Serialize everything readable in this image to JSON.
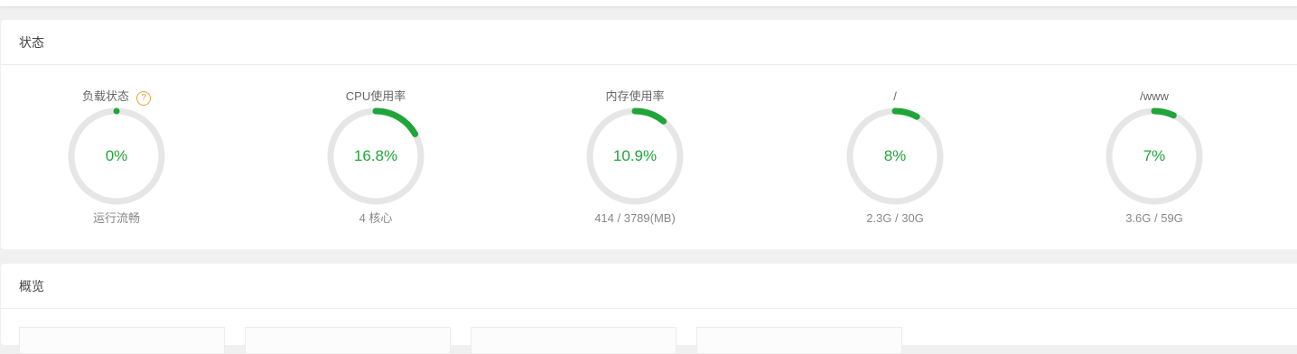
{
  "status_panel": {
    "title": "状态",
    "gauges": [
      {
        "key": "load",
        "label": "负载状态",
        "has_help": true,
        "help_glyph": "?",
        "value_text": "0%",
        "percent": 0,
        "detail": "运行流畅"
      },
      {
        "key": "cpu",
        "label": "CPU使用率",
        "has_help": false,
        "value_text": "16.8%",
        "percent": 16.8,
        "detail": "4 核心"
      },
      {
        "key": "memory",
        "label": "内存使用率",
        "has_help": false,
        "value_text": "10.9%",
        "percent": 10.9,
        "detail": "414 / 3789(MB)"
      },
      {
        "key": "disk-root",
        "label": "/",
        "has_help": false,
        "value_text": "8%",
        "percent": 8,
        "detail": "2.3G / 30G"
      },
      {
        "key": "disk-www",
        "label": "/www",
        "has_help": false,
        "value_text": "7%",
        "percent": 7,
        "detail": "3.6G / 59G"
      }
    ]
  },
  "overview_panel": {
    "title": "概览",
    "card_count": 4
  },
  "colors": {
    "accent_green": "#20a53a",
    "ring_track": "#e6e6e6",
    "help_orange": "#e6a23c"
  }
}
